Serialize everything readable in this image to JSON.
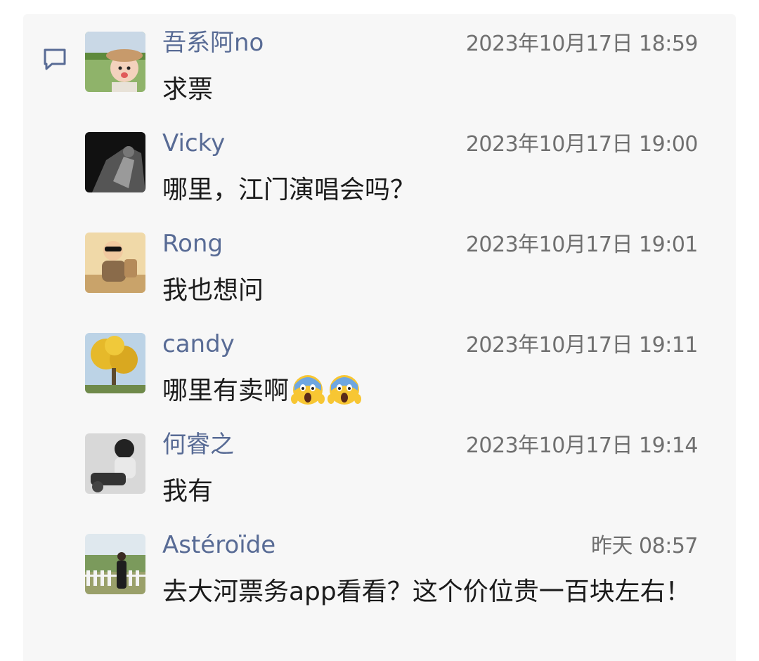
{
  "comments": [
    {
      "name": "吾系阿no",
      "time": "2023年10月17日 18:59",
      "text": "求票",
      "avatar": "avatar-girl-hat-icon"
    },
    {
      "name": "Vicky",
      "time": "2023年10月17日 19:00",
      "text": "哪里，江门演唱会吗？",
      "avatar": "avatar-dark-photo-icon"
    },
    {
      "name": "Rong",
      "time": "2023年10月17日 19:01",
      "text": "我也想问",
      "avatar": "avatar-cartoon-kid-icon"
    },
    {
      "name": "candy",
      "time": "2023年10月17日 19:11",
      "text": "哪里有卖啊",
      "emojis": [
        "screaming-face-emoji",
        "screaming-face-emoji"
      ],
      "avatar": "avatar-yellow-tree-icon"
    },
    {
      "name": "何睿之",
      "time": "2023年10月17日 19:14",
      "text": "我有",
      "avatar": "avatar-motorbike-rider-icon"
    },
    {
      "name": "Astéroïde",
      "time": "昨天 08:57",
      "text": "去大河票务app看看？这个价位贵一百块左右！",
      "avatar": "avatar-fence-person-icon"
    }
  ],
  "colors": {
    "name": "#586b95",
    "time": "#6f6f6f",
    "text": "#1b1b1b",
    "panel": "#f7f7f7",
    "comment_icon": "#586b95"
  },
  "icons": {
    "comment_section": "comment-bubble-icon"
  }
}
